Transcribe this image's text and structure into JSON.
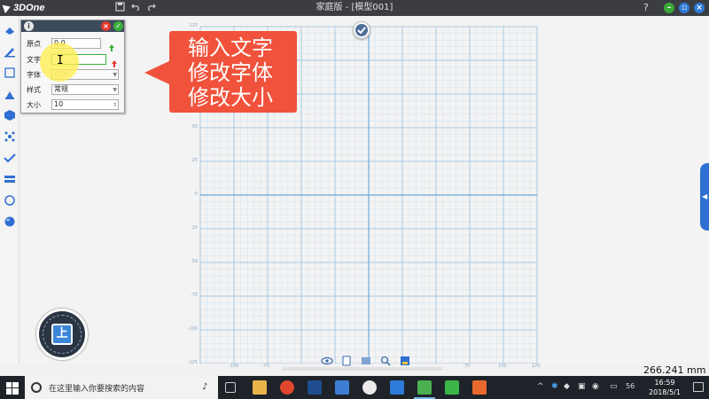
{
  "app": {
    "logo_text": "3DOne",
    "window_title": "家庭版 - [模型001]",
    "help_label": "?"
  },
  "dialog": {
    "rows": [
      {
        "label": "原点",
        "value": "0,0"
      },
      {
        "label": "文字",
        "value": ""
      },
      {
        "label": "字体",
        "value": "仿宋"
      },
      {
        "label": "样式",
        "value": "常规"
      },
      {
        "label": "大小",
        "value": "10"
      }
    ]
  },
  "callout": {
    "lines": [
      "输入文字",
      "修改字体",
      "修改大小"
    ],
    "color": "#f0523b"
  },
  "grid": {
    "x_labels": [
      "-100",
      "-75",
      "75",
      "100",
      "125"
    ],
    "y_labels": [
      "125",
      "50",
      "25",
      "0",
      "-25",
      "-50",
      "-75",
      "-100",
      "-125"
    ]
  },
  "viewcube": {
    "face_label": "上"
  },
  "status": {
    "scale_readout": "266.241 mm"
  },
  "taskbar": {
    "search_placeholder": "在这里输入你要搜索的内容",
    "clock_time": "16:59",
    "clock_date": "2018/5/1",
    "tray_badge": "56"
  },
  "colors": {
    "titlebar": "#3b3d42",
    "grid_major": "#a8c8e0",
    "grid_minor": "#d6e6f2",
    "accent_blue": "#2f6fd1"
  }
}
